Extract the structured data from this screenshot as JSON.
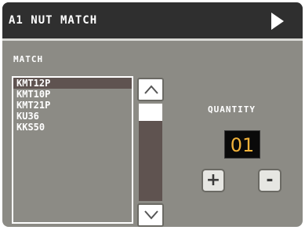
{
  "window": {
    "title": "A1 NUT MATCH"
  },
  "match": {
    "label": "MATCH",
    "items": [
      {
        "label": "KMT12P",
        "selected": true
      },
      {
        "label": "KMT10P",
        "selected": false
      },
      {
        "label": "KMT21P",
        "selected": false
      },
      {
        "label": "KU36",
        "selected": false
      },
      {
        "label": "KKS50",
        "selected": false
      }
    ]
  },
  "quantity": {
    "label": "QUANTITY",
    "value": "01",
    "plus_label": "+",
    "minus_label": "-"
  },
  "icons": {
    "play": "play-arrow-icon",
    "scroll_up": "chevron-up-icon",
    "scroll_down": "chevron-down-icon"
  },
  "colors": {
    "panel_bg": "#8c8b85",
    "titlebar_bg": "#2f2f2f",
    "selection_bg": "#5f5350",
    "qty_text": "#f2b23a"
  }
}
